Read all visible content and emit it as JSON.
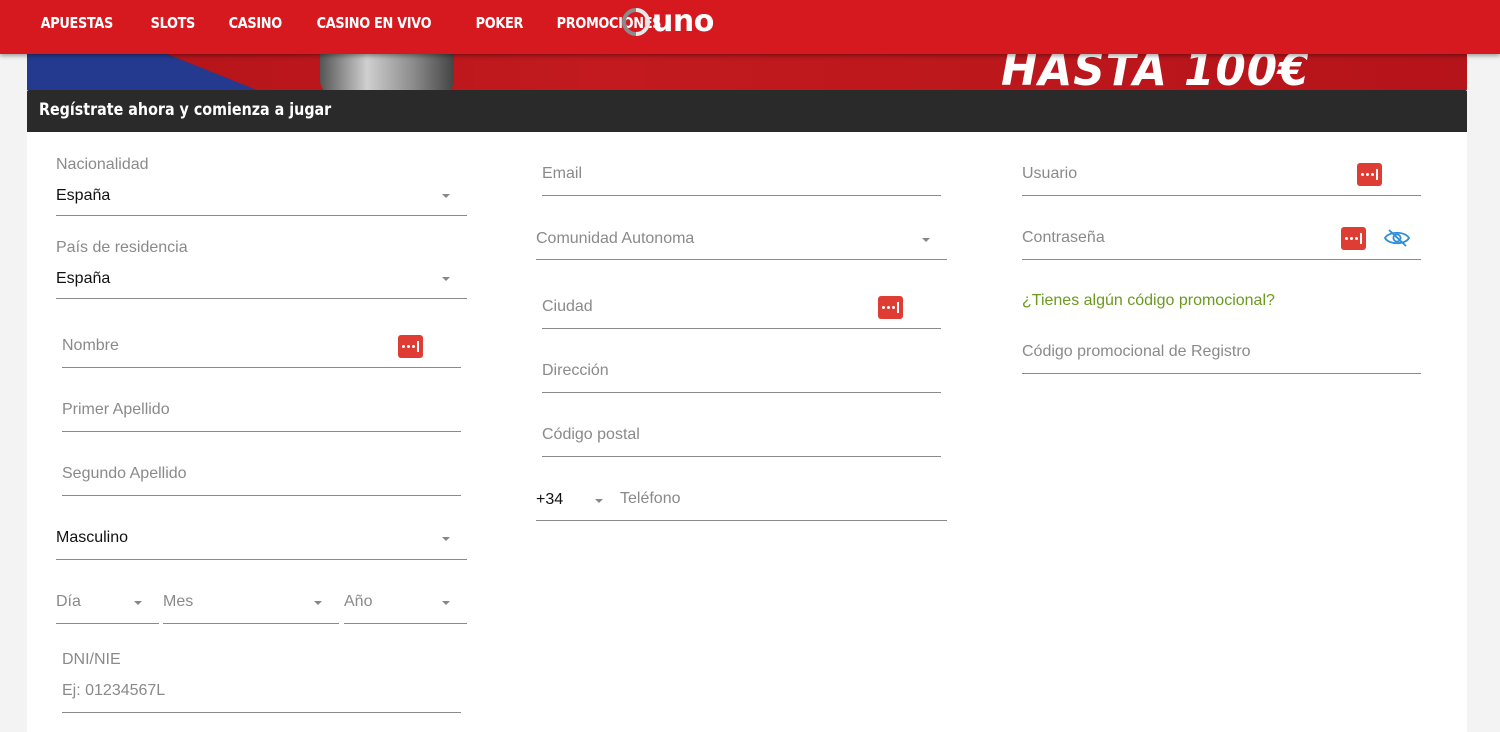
{
  "nav": {
    "items": [
      "APUESTAS",
      "SLOTS",
      "CASINO",
      "CASINO EN VIVO",
      "POKER",
      "PROMOCIONES"
    ],
    "brand": "uno"
  },
  "banner": {
    "text": "HASTA 100€"
  },
  "form": {
    "title": "Regístrate ahora y comienza a jugar",
    "nationality": {
      "label": "Nacionalidad",
      "value": "España"
    },
    "residence": {
      "label": "País de residencia",
      "value": "España"
    },
    "first_name": {
      "placeholder": "Nombre"
    },
    "last_name_1": {
      "placeholder": "Primer Apellido"
    },
    "last_name_2": {
      "placeholder": "Segundo Apellido"
    },
    "gender": {
      "value": "Masculino"
    },
    "birth": {
      "day": "Día",
      "month": "Mes",
      "year": "Año"
    },
    "dni": {
      "label": "DNI/NIE",
      "placeholder": "Ej: 01234567L"
    },
    "email": {
      "placeholder": "Email"
    },
    "region": {
      "placeholder": "Comunidad Autonoma"
    },
    "city": {
      "placeholder": "Ciudad"
    },
    "address": {
      "placeholder": "Dirección"
    },
    "postal_code": {
      "placeholder": "Código postal"
    },
    "phone": {
      "prefix": "+34",
      "placeholder": "Teléfono"
    },
    "username": {
      "placeholder": "Usuario"
    },
    "password": {
      "placeholder": "Contraseña"
    },
    "promo_link": "¿Tienes algún código promocional?",
    "promo_code": {
      "placeholder": "Código promocional de Registro"
    }
  },
  "colors": {
    "topbar": "#d6181f",
    "header": "#2a2a2a",
    "link": "#6a9a1f",
    "keypass": "#df3d34",
    "eye": "#2d8fd5"
  },
  "icons": [
    "uno-logo-icon",
    "password-manager-icon",
    "eye-hidden-icon",
    "chevron-down-icon"
  ]
}
